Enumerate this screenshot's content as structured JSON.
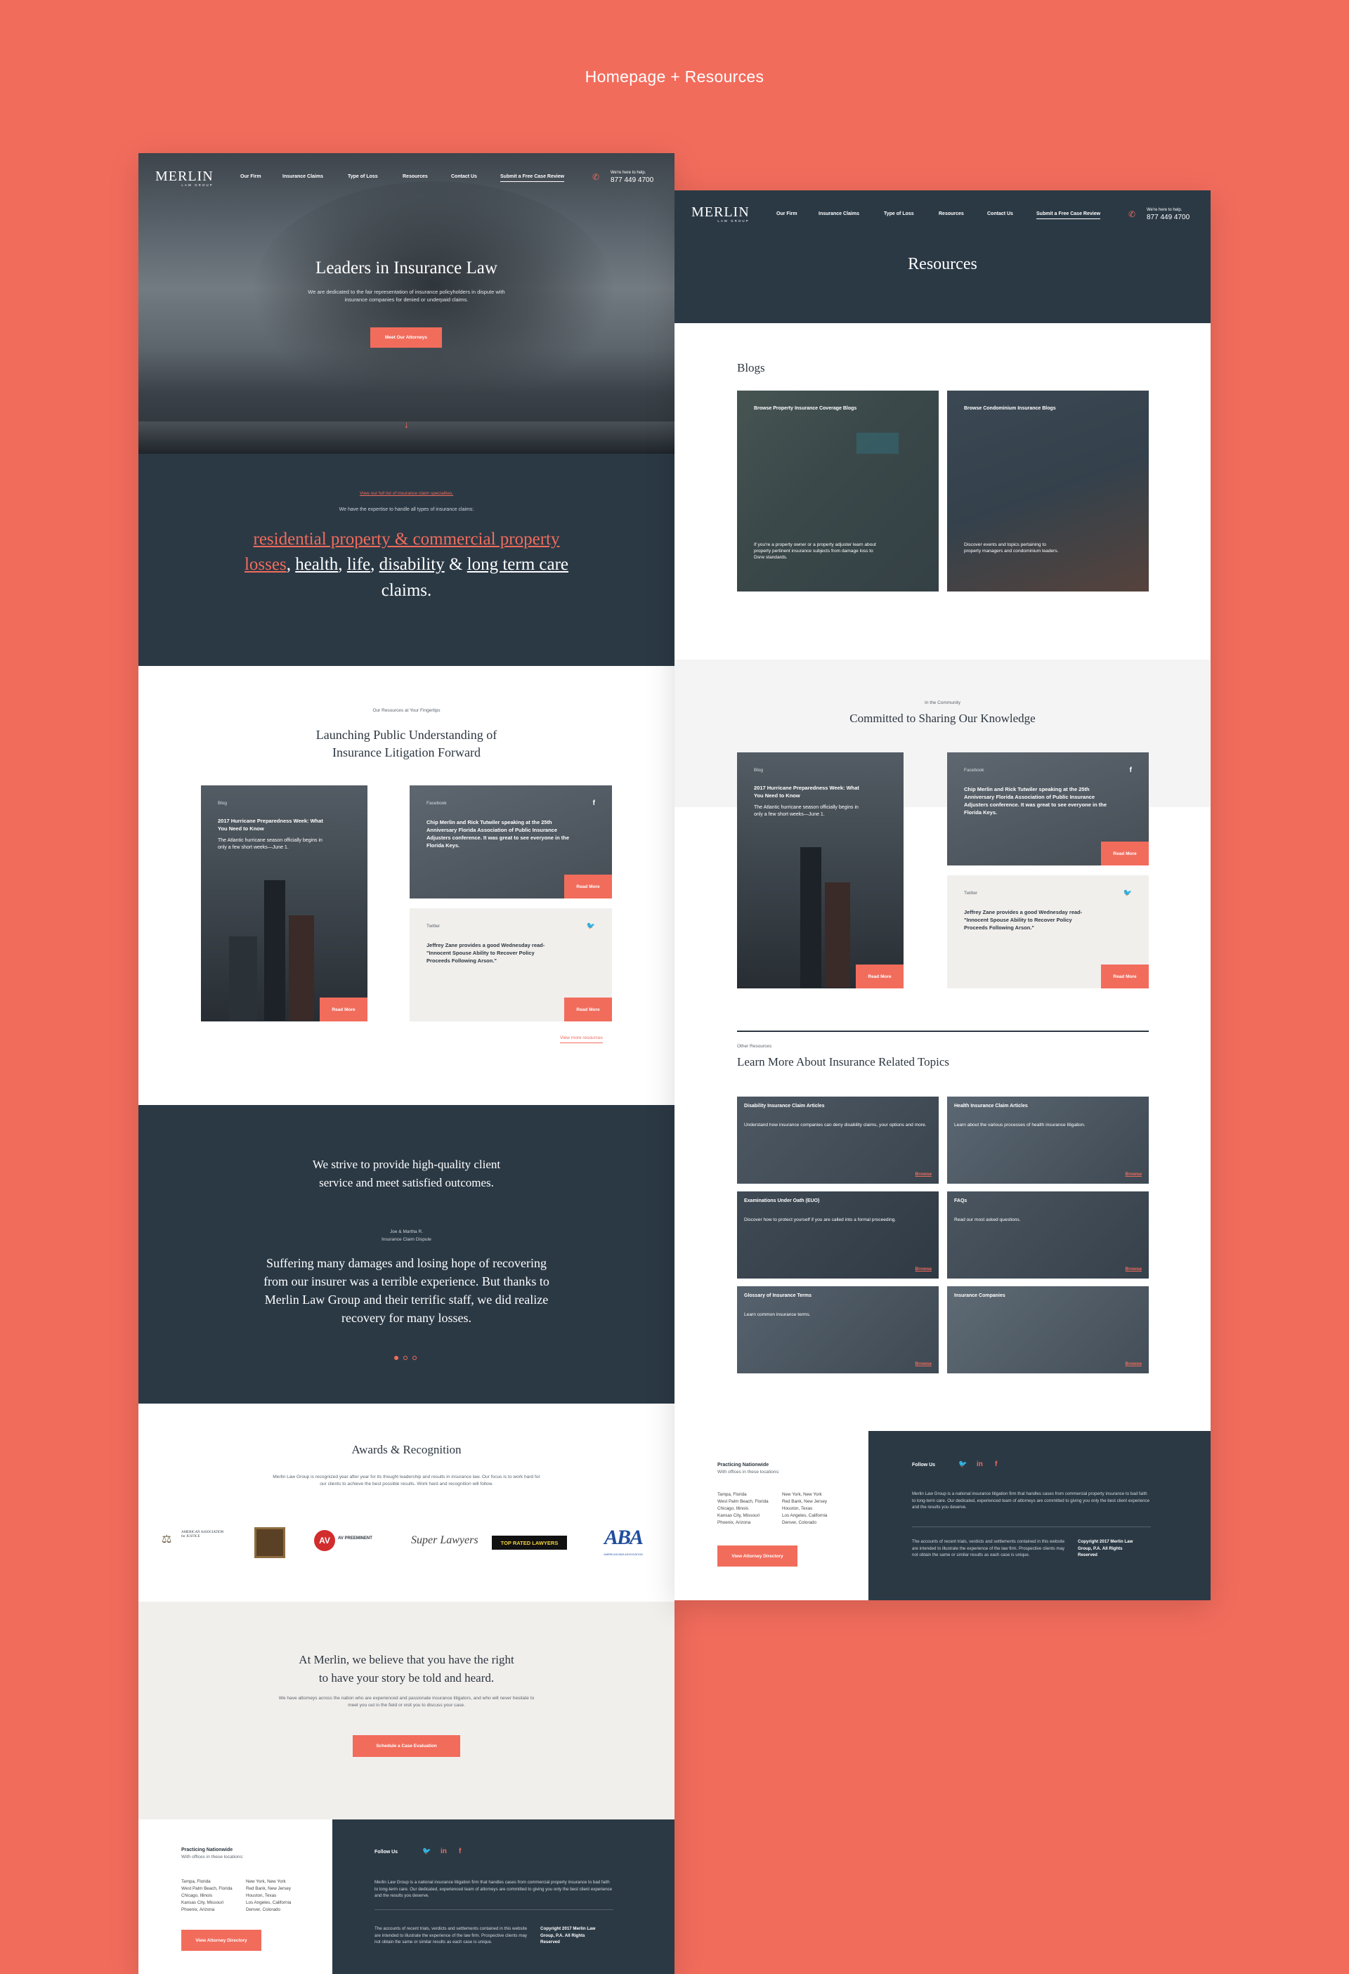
{
  "showcase_title": "Homepage + Resources",
  "colors": {
    "coral": "#f26c5c",
    "navy": "#2b3945",
    "light": "#f1efec"
  },
  "nav": {
    "logo": "MERLIN",
    "logo_sub": "LAW GROUP",
    "items": [
      "Our Firm",
      "Insurance Claims",
      "Type of Loss",
      "Resources",
      "Contact Us"
    ],
    "cta": "Submit a Free Case Review",
    "help": "We're here to help.",
    "phone": "877 449 4700"
  },
  "home": {
    "hero": {
      "title": "Leaders in Insurance Law",
      "subtitle": "We are dedicated to the fair representation of insurance policyholders in dispute with insurance companies for denied or underpaid claims.",
      "button": "Meet Our Attorneys"
    },
    "expertise": {
      "intro": "We have the expertise to handle all types of insurance claims:",
      "link1": "residential property & commercial property losses",
      "sep1": ",",
      "link2": "health",
      "sep2": ",",
      "link3": "life",
      "sep3": ",",
      "link4": "disability",
      "sep4": " &",
      "link5": "long term care",
      "tail": "claims.",
      "cta": "View our full list of insurance claim specialties."
    },
    "resources": {
      "eyebrow": "Our Resources at Your Fingertips",
      "title_line1": "Launching Public Understanding of",
      "title_line2": "Insurance Litigation Forward",
      "blog": {
        "label": "Blog",
        "title": "2017 Hurricane Preparedness Week: What You Need to Know",
        "desc": "The Atlantic hurricane season officially begins in only a few short weeks—June 1.",
        "button": "Read More"
      },
      "facebook": {
        "label": "Facebook",
        "title": "Chip Merlin and Rick Tutwiler speaking at the 25th Anniversary Florida Association of Public Insurance Adjusters conference. It was great to see everyone in the Florida Keys.",
        "button": "Read More"
      },
      "twitter": {
        "label": "Twitter",
        "title": "Jeffrey Zane provides a good Wednesday read- \"Innocent Spouse Ability to Recover Policy Proceeds Following Arson.\"",
        "button": "Read More"
      },
      "more": "View more resources"
    },
    "testimonial": {
      "heading_line1": "We strive to provide high-quality client",
      "heading_line2": "service and meet satisfied outcomes.",
      "author": "Joe & Martha R.",
      "role": "Insurance Claim Dispute",
      "quote_line1": "Suffering many damages and losing hope of recovering",
      "quote_line2": "from our insurer was a terrible experience. But thanks to",
      "quote_line3": "Merlin Law Group and their terrific staff, we did realize",
      "quote_line4": "recovery for many losses."
    },
    "awards": {
      "title": "Awards & Recognition",
      "desc": "Merlin Law Group is recognized year after year for its thought leadership and results in insurance law. Our focus is to work hard for our clients to achieve the best possible results. Work hard and recognition will follow.",
      "logos": [
        "AMERICAN ASSOCIATION for JUSTICE",
        "AV",
        "AV PREEMINENT",
        "Super Lawyers",
        "TOP RATED LAWYERS",
        "ABA",
        "AMERICAN BAR ASSOCIATION"
      ]
    },
    "story": {
      "title_line1": "At Merlin, we believe that you have the right",
      "title_line2": "to have your story be told and heard.",
      "desc": "We have attorneys across the nation who are experienced and passionate insurance litigators, and who will never hesitate to meet you out in the field or visit you to discuss your case.",
      "button": "Schedule a Case Evaluation"
    }
  },
  "footer": {
    "practicing": "Practicing Nationwide",
    "offices_intro": "With offices in these locations:",
    "locations_col1": [
      "Tampa, Florida",
      "West Palm Beach, Florida",
      "Chicago, Illinois",
      "Kansas City, Missouri",
      "Phoenix, Arizona"
    ],
    "locations_col2": [
      "New York, New York",
      "Red Bank, New Jersey",
      "Houston, Texas",
      "Los Angeles, California",
      "Denver, Colorado"
    ],
    "directory_button": "View Attorney Directory",
    "follow": "Follow Us",
    "about": "Merlin Law Group is a national insurance litigation firm that handles cases from commercial property insurance to bad faith to long-term care. Our dedicated, experienced team of attorneys are committed to giving you only the best client experience and the results you deserve.",
    "disclaimer": "The accounts of recent trials, verdicts and settlements contained in this website are intended to illustrate the experience of the law firm. Prospective clients may not obtain the same or similar results as each case is unique.",
    "copyright": "Copyright 2017 Merlin Law Group, P.A. All Rights Reserved"
  },
  "resources_page": {
    "title": "Resources",
    "blogs_heading": "Blogs",
    "blog_cards": [
      {
        "title": "Browse Property Insurance Coverage Blogs",
        "desc": "If you're a property owner or a property adjuster learn about property pertinent insurance subjects from damage loss to Dsrw standards."
      },
      {
        "title": "Browse Condominium Insurance Blogs",
        "desc": "Discover events and topics pertaining to property managers and condominium leaders."
      }
    ],
    "community_eyebrow": "In the Community",
    "community_title": "Committed to Sharing Our Knowledge",
    "other_eyebrow": "Other Resources",
    "other_title": "Learn More About Insurance Related Topics",
    "topics": [
      {
        "title": "Disability Insurance Claim Articles",
        "desc": "Understand how insurance companies can deny disability claims, your options and more.",
        "link": "Browse"
      },
      {
        "title": "Health Insurance Claim Articles",
        "desc": "Learn about the various processes of health insurance litigation.",
        "link": "Browse"
      },
      {
        "title": "Examinations Under Oath (EUO)",
        "desc": "Discover how to protect yourself if you are called into a formal proceeding.",
        "link": "Browse"
      },
      {
        "title": "FAQs",
        "desc": "Read our most asked questions.",
        "link": "Browse"
      },
      {
        "title": "Glossary of Insurance Terms",
        "desc": "Learn common insurance terms.",
        "link": "Browse"
      },
      {
        "title": "Insurance Companies",
        "desc": "",
        "link": "Browse"
      }
    ]
  }
}
